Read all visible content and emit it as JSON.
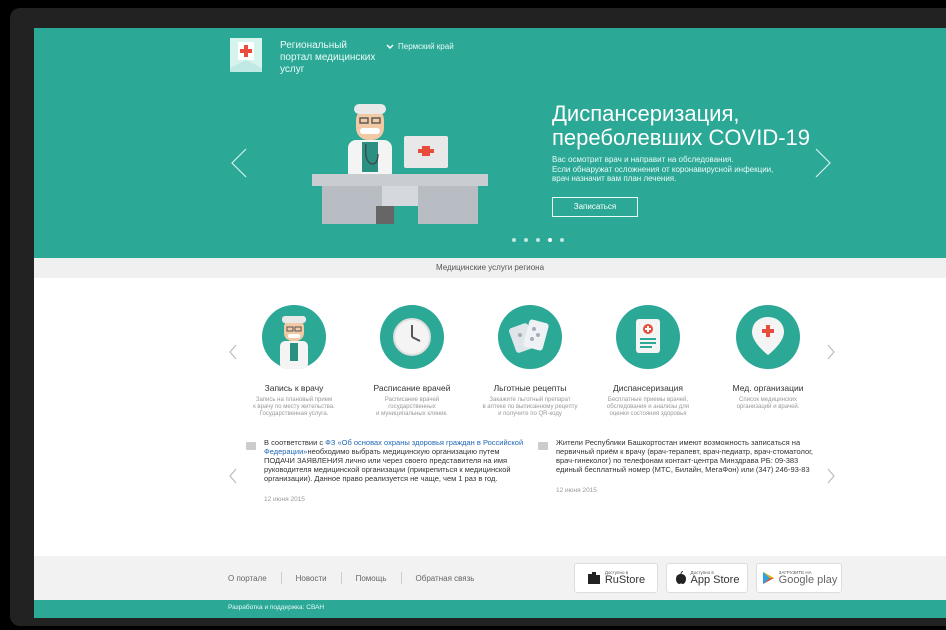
{
  "header": {
    "portal_title": "Региональный портал медицинских услуг",
    "region": "Пермский край"
  },
  "hero": {
    "title": "Диспансеризация, переболевших COVID-19",
    "text": "Вас осмотрит врач и направит на обследования.\nЕсли обнаружат осложнения от коронавирусной инфекции,\nврач назначит вам план лечения.",
    "button": "Записаться",
    "slides_total": 5,
    "slide_active": 4
  },
  "services": {
    "strip_title": "Медицинские услуги региона",
    "items": [
      {
        "title": "Запись к врачу",
        "desc": "Запись на плановый прием\nк врачу по месту жительства.\nГосударственная услуга.",
        "icon": "doctor-icon"
      },
      {
        "title": "Расписание врачей",
        "desc": "Расписание врачей\nгосударственных\nи муниципальных клиник.",
        "icon": "clock-icon"
      },
      {
        "title": "Льготные рецепты",
        "desc": "Закажите льготный препарат\nв аптеке по выписанному рецепту\nи получите по QR-коду",
        "icon": "pills-icon"
      },
      {
        "title": "Диспансеризация",
        "desc": "Бесплатные приемы врачей,\nобследования и анализы для\nоценки состояния здоровья",
        "icon": "clipboard-icon"
      },
      {
        "title": "Мед. организации",
        "desc": "Список медицинских\nорганизаций и врачей.",
        "icon": "map-pin-icon"
      }
    ]
  },
  "news": [
    {
      "prefix": "В соответствии с ",
      "link": "ФЗ «Об основах охраны здоровья граждан в Российской Федерации»",
      "text": "необходимо выбрать медицинскую организацию путем ПОДАЧИ ЗАЯВЛЕНИЯ лично или через своего представителя на имя руководителя медицинской организации (прикрепиться к медицинской организации). Данное право реализуется не чаще, чем 1 раз в год.",
      "date": "12 июня 2015"
    },
    {
      "prefix": "",
      "link": "",
      "text": "Жители Республики Башкортостан имеют возможность записаться на первичный приём к врачу (врач-терапевт, врач-педиатр, врач-стоматолог, врач-гинеколог) по телефонам контакт-центра Минздрава РБ: 09-383 единый бесплатный номер (МТС, Билайн, МегаФон) или (347) 246-93-83",
      "date": "12 июня 2015"
    }
  ],
  "footer": {
    "links": [
      "О портале",
      "Новости",
      "Помощь",
      "Обратная связь"
    ],
    "stores": [
      {
        "small": "Доступно в",
        "big": "RuStore",
        "icon": "rustore-icon"
      },
      {
        "small": "Доступно в",
        "big": "App Store",
        "icon": "apple-icon"
      },
      {
        "small": "ЗАГРУЗИТЕ НА",
        "big": "Google play",
        "icon": "google-play-icon"
      }
    ],
    "credits": "Разработка и поддержка: СВАН"
  },
  "colors": {
    "accent": "#2ba896",
    "footer_bg": "#f2f2f2"
  }
}
